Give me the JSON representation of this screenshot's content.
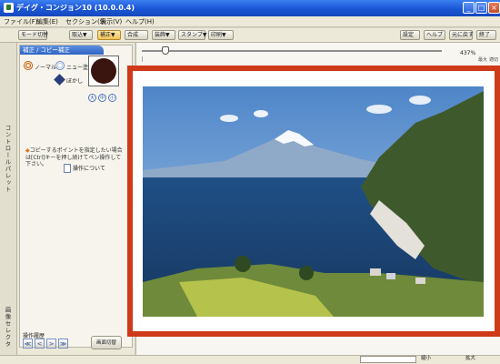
{
  "window": {
    "title": "デイグ・コンジョン10 (10.0.0.4)"
  },
  "menu": [
    "ファイル(F)",
    "編集(E)",
    "セクション(S)",
    "表示(V)",
    "ヘルプ(H)"
  ],
  "toolbar": {
    "left_buttons": [
      "モード切替",
      "取込▼",
      "補正▼",
      "合成",
      "装飾▼",
      "スタンプ▼",
      "印刷▼"
    ],
    "right_buttons": [
      "設定",
      "ヘルプ",
      "元に戻す",
      "終了"
    ],
    "active_index": 2
  },
  "left_panel": {
    "vertical_tabs": {
      "control_palette": "コントロールパレット",
      "image_selector": "画像セレクタ"
    },
    "mode_tab_label": "補正 / コピー補正",
    "options": {
      "normal": "ノーマル",
      "new_paint": "ニュー塗",
      "soft": "ぼかし"
    },
    "round_icons": [
      "大",
      "中",
      "小"
    ],
    "hint": "コピーするポイントを指定したい場合は[Ctrl]キーを押し続けてペン操作して下さい。",
    "about_button": "操作について",
    "history_label": "操作履歴",
    "nav_buttons": [
      "≪",
      "<",
      ">",
      "≫"
    ],
    "edit_screen_button": "画面切替"
  },
  "canvas": {
    "zoom_readout": "437%",
    "zoom_minor": [
      "最大",
      "適切"
    ]
  },
  "status": {
    "field_value": "",
    "buttons": [
      "縮小",
      "拡大"
    ]
  },
  "colors": {
    "frame": "#cf3a19",
    "titlebar": "#2a63d8",
    "swatch": "#3a1510"
  }
}
